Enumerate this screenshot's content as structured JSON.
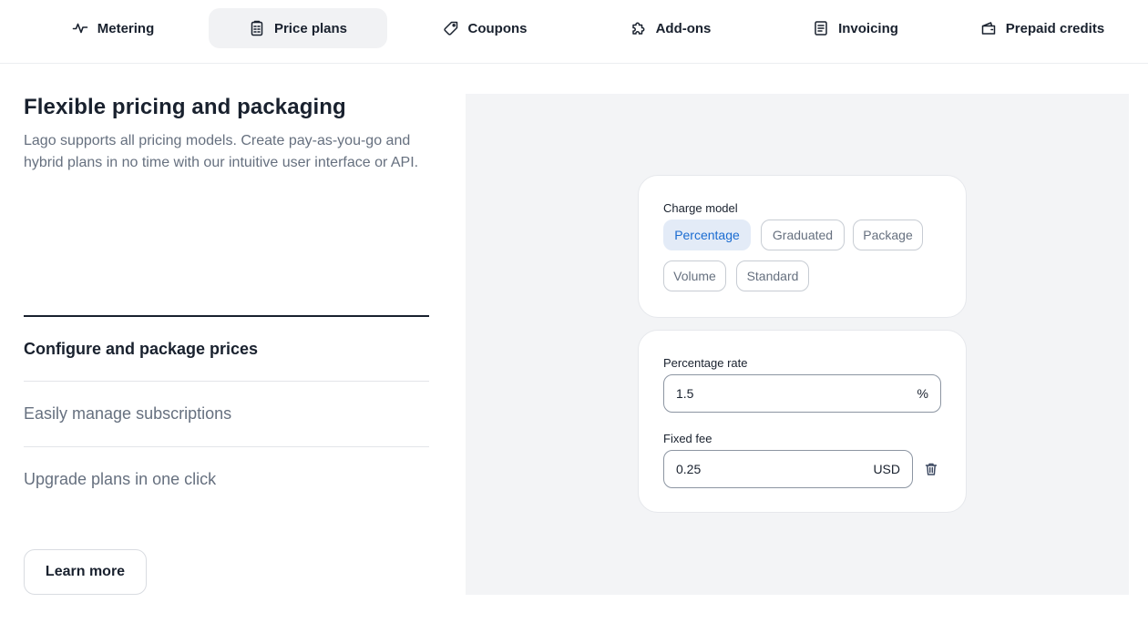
{
  "tabs": [
    {
      "label": "Metering",
      "icon": "pulse-icon",
      "active": false
    },
    {
      "label": "Price plans",
      "icon": "clipboard-icon",
      "active": true
    },
    {
      "label": "Coupons",
      "icon": "tag-icon",
      "active": false
    },
    {
      "label": "Add-ons",
      "icon": "puzzle-icon",
      "active": false
    },
    {
      "label": "Invoicing",
      "icon": "document-icon",
      "active": false
    },
    {
      "label": "Prepaid credits",
      "icon": "wallet-icon",
      "active": false
    }
  ],
  "section": {
    "title": "Flexible pricing and packaging",
    "description": "Lago supports all pricing models. Create pay-as-you-go and hybrid plans in no time with our intuitive user interface or API."
  },
  "features": [
    {
      "label": "Configure and package prices",
      "active": true
    },
    {
      "label": "Easily manage subscriptions",
      "active": false
    },
    {
      "label": "Upgrade plans in one click",
      "active": false
    }
  ],
  "learn_more_label": "Learn more",
  "charge_model": {
    "label": "Charge model",
    "options": [
      "Percentage",
      "Graduated",
      "Package",
      "Volume",
      "Standard"
    ],
    "selected": "Percentage"
  },
  "percentage_rate": {
    "label": "Percentage rate",
    "value": "1.5",
    "suffix": "%"
  },
  "fixed_fee": {
    "label": "Fixed fee",
    "value": "0.25",
    "suffix": "USD"
  },
  "colors": {
    "accent": "#1b6cd1",
    "chip_selected_bg": "#e3ebf7",
    "panel_bg": "#f3f4f6"
  }
}
